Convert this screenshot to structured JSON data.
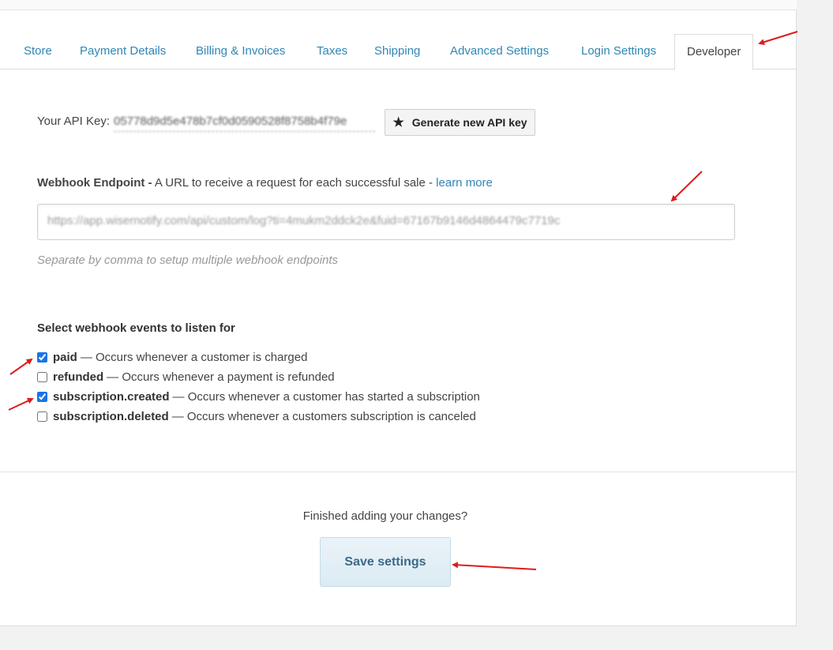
{
  "tabs": [
    {
      "label": "Store"
    },
    {
      "label": "Payment Details"
    },
    {
      "label": "Billing & Invoices"
    },
    {
      "label": "Taxes"
    },
    {
      "label": "Shipping"
    },
    {
      "label": "Advanced Settings"
    },
    {
      "label": "Login Settings"
    },
    {
      "label": "Developer"
    }
  ],
  "api": {
    "label": "Your API Key:",
    "value": "05778d9d5e478b7cf0d0590528f8758b4f79e",
    "generate_label": "Generate new API key"
  },
  "webhook": {
    "title_bold": "Webhook Endpoint -",
    "title_rest": " A URL to receive a request for each successful sale - ",
    "learn_more": "learn more",
    "value": "https://app.wisernotify.com/api/custom/log?ti=4mukm2ddck2e&fuid=67167b9146d4864479c7719c",
    "hint": "Separate by comma to setup multiple webhook endpoints"
  },
  "events": {
    "title": "Select webhook events to listen for",
    "items": [
      {
        "name": "paid",
        "desc": "— Occurs whenever a customer is charged",
        "checked": true
      },
      {
        "name": "refunded",
        "desc": "— Occurs whenever a payment is refunded",
        "checked": false
      },
      {
        "name": "subscription.created",
        "desc": "— Occurs whenever a customer has started a subscription",
        "checked": true
      },
      {
        "name": "subscription.deleted",
        "desc": "— Occurs whenever a customers subscription is canceled",
        "checked": false
      }
    ]
  },
  "footer": {
    "prompt": "Finished adding your changes?",
    "save_label": "Save settings"
  },
  "colors": {
    "link": "#2f86b5",
    "annotation_arrow": "#e01b1b"
  }
}
